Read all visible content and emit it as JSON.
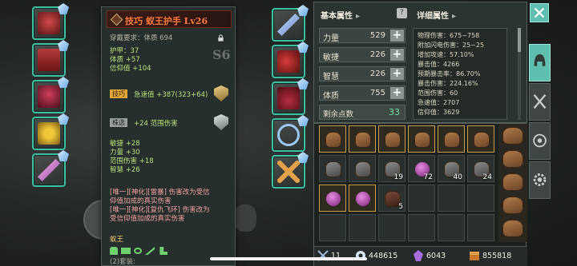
{
  "tooltip": {
    "title": "技巧 蚁王护手 Lv26",
    "requirement": "穿戴要求：体质 694",
    "grade": "S6",
    "base_stats": [
      "护甲：37",
      "体质 +57",
      "信仰值 +104"
    ],
    "sub1_tag": "技巧",
    "sub1_text": "急速值 +387(323+64)",
    "sub2_tag": "株选",
    "sub2_text": "+24 范围伤害",
    "bonus_stats": [
      "敏捷 +28",
      "力量 +30",
      "范围伤害 +18",
      "智慧 +26"
    ],
    "effects": [
      "[唯一][神化][雷暴] 伤害改为受信",
      "仰值加成的真实伤害",
      "[唯一][神化][复仇飞环] 伤害改为",
      "受信仰值加成的真实伤害"
    ],
    "set_name": "蚁王",
    "set_count": "(2)套装:"
  },
  "stats": {
    "basic_header": "基本属性",
    "detail_header": "详细属性",
    "help_icon": "?",
    "attributes": [
      {
        "label": "力量",
        "value": "529"
      },
      {
        "label": "敏捷",
        "value": "226"
      },
      {
        "label": "智慧",
        "value": "226"
      },
      {
        "label": "体质",
        "value": "755"
      }
    ],
    "remain_label": "剩余点数",
    "remain_value": "33",
    "details": [
      "物理伤害：675~758",
      "附加闪电伤害：25~25",
      "增加攻速：57.10%",
      "暴击值：4266",
      "预期暴击率：86.70%",
      "暴击伤害：224.16%",
      "范围伤害：60",
      "急速值：2707",
      "信仰值：3629"
    ]
  },
  "inventory": {
    "counts": {
      "c19": "19",
      "c72": "72",
      "c40": "40",
      "c24": "24",
      "c5": "5"
    },
    "bar": {
      "slots": "11",
      "gold": "448615",
      "gems": "6043",
      "currency": "855818"
    }
  },
  "colors": {
    "accent": "#5fbfae",
    "slot_border": "#3ec0a0",
    "title": "#ff7a3c"
  },
  "icons": {
    "close": "close-icon",
    "helmet": "helmet-icon",
    "weapon": "crossed-swords-icon",
    "target": "target-icon",
    "settings": "gear-icon"
  }
}
